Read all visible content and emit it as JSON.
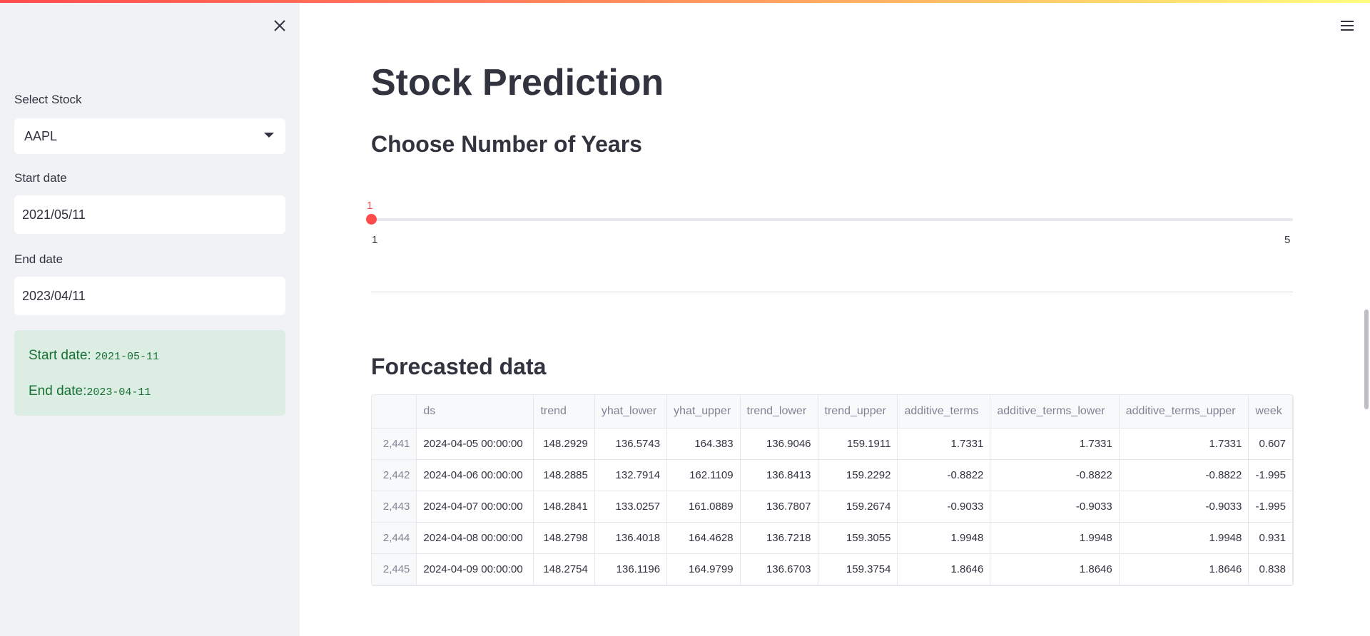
{
  "sidebar": {
    "select_stock_label": "Select Stock",
    "select_stock_value": "AAPL",
    "start_date_label": "Start date",
    "start_date_value": "2021/05/11",
    "end_date_label": "End date",
    "end_date_value": "2023/04/11",
    "info": {
      "start_prefix": "Start date: ",
      "start_code": "2021-05-11",
      "end_prefix": "End date:",
      "end_code": "2023-04-11"
    }
  },
  "main": {
    "title": "Stock Prediction",
    "years_heading": "Choose Number of Years",
    "slider": {
      "value": "1",
      "min": "1",
      "max": "5"
    },
    "forecast_heading": "Forecasted data"
  },
  "table": {
    "columns": [
      "",
      "ds",
      "trend",
      "yhat_lower",
      "yhat_upper",
      "trend_lower",
      "trend_upper",
      "additive_terms",
      "additive_terms_lower",
      "additive_terms_upper",
      "week"
    ],
    "rows": [
      [
        "2,441",
        "2024-04-05 00:00:00",
        "148.2929",
        "136.5743",
        "164.383",
        "136.9046",
        "159.1911",
        "1.7331",
        "1.7331",
        "1.7331",
        "0.607"
      ],
      [
        "2,442",
        "2024-04-06 00:00:00",
        "148.2885",
        "132.7914",
        "162.1109",
        "136.8413",
        "159.2292",
        "-0.8822",
        "-0.8822",
        "-0.8822",
        "-1.995"
      ],
      [
        "2,443",
        "2024-04-07 00:00:00",
        "148.2841",
        "133.0257",
        "161.0889",
        "136.7807",
        "159.2674",
        "-0.9033",
        "-0.9033",
        "-0.9033",
        "-1.995"
      ],
      [
        "2,444",
        "2024-04-08 00:00:00",
        "148.2798",
        "136.4018",
        "164.4628",
        "136.7218",
        "159.3055",
        "1.9948",
        "1.9948",
        "1.9948",
        "0.931"
      ],
      [
        "2,445",
        "2024-04-09 00:00:00",
        "148.2754",
        "136.1196",
        "164.9799",
        "136.6703",
        "159.3754",
        "1.8646",
        "1.8646",
        "1.8646",
        "0.838"
      ]
    ]
  },
  "colors": {
    "accent": "#ff4b4b",
    "sidebar_bg": "#f0f2f6",
    "success_bg": "#dcede4",
    "success_text": "#177233"
  },
  "icons": {
    "close": "close-icon",
    "menu": "hamburger-menu-icon",
    "select": "chevron-down-icon"
  }
}
